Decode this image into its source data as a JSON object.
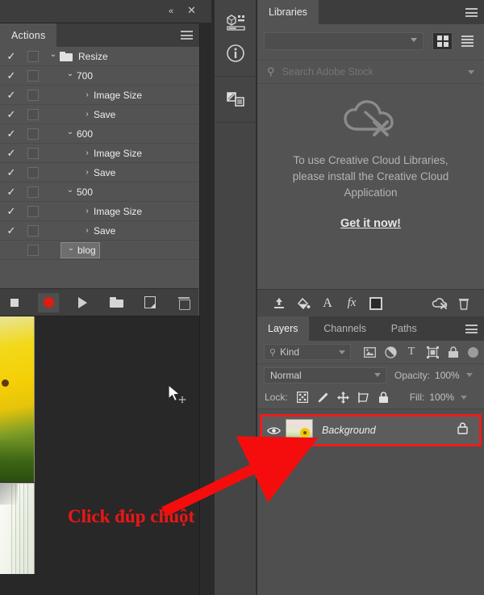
{
  "app": "Adobe Photoshop",
  "actions_panel": {
    "tab_label": "Actions",
    "collapse_icon": "double-chevron-left-icon",
    "close_icon": "close-icon",
    "menu_icon": "panel-menu-icon",
    "rows": [
      {
        "check": "✓",
        "box": true,
        "chevron": "⌄",
        "folder": true,
        "indent": 0,
        "label": "Resize",
        "selected": false
      },
      {
        "check": "✓",
        "box": true,
        "chevron": "⌄",
        "folder": false,
        "indent": 1,
        "label": "700",
        "selected": false
      },
      {
        "check": "✓",
        "box": true,
        "chevron": "›",
        "folder": false,
        "indent": 2,
        "label": "Image Size",
        "selected": false
      },
      {
        "check": "✓",
        "box": true,
        "chevron": "›",
        "folder": false,
        "indent": 2,
        "label": "Save",
        "selected": false
      },
      {
        "check": "✓",
        "box": true,
        "chevron": "⌄",
        "folder": false,
        "indent": 1,
        "label": "600",
        "selected": false
      },
      {
        "check": "✓",
        "box": true,
        "chevron": "›",
        "folder": false,
        "indent": 2,
        "label": "Image Size",
        "selected": false
      },
      {
        "check": "✓",
        "box": true,
        "chevron": "›",
        "folder": false,
        "indent": 2,
        "label": "Save",
        "selected": false
      },
      {
        "check": "✓",
        "box": true,
        "chevron": "⌄",
        "folder": false,
        "indent": 1,
        "label": "500",
        "selected": false
      },
      {
        "check": "✓",
        "box": true,
        "chevron": "›",
        "folder": false,
        "indent": 2,
        "label": "Image Size",
        "selected": false
      },
      {
        "check": "✓",
        "box": true,
        "chevron": "›",
        "folder": false,
        "indent": 2,
        "label": "Save",
        "selected": false
      },
      {
        "check": "",
        "box": true,
        "chevron": "⌄",
        "folder": false,
        "indent": 1,
        "label": "blog",
        "selected": true
      }
    ],
    "toolbar": [
      {
        "name": "stop-button",
        "title": "Stop"
      },
      {
        "name": "record-button",
        "title": "Begin recording"
      },
      {
        "name": "play-button",
        "title": "Play selection"
      },
      {
        "name": "new-set-button",
        "title": "Create new set"
      },
      {
        "name": "new-action-button",
        "title": "Create new action"
      },
      {
        "name": "delete-button",
        "title": "Delete"
      }
    ]
  },
  "icon_rail": {
    "items": [
      {
        "name": "properties-icon",
        "title": "Properties"
      },
      {
        "name": "info-icon",
        "title": "Info"
      },
      {
        "name": "adjustments-icon",
        "title": "Adjustments"
      }
    ]
  },
  "libraries": {
    "tab_label": "Libraries",
    "menu_icon": "panel-menu-icon",
    "library_select_value": "",
    "view_grid_icon": "grid-view-icon",
    "view_list_icon": "list-view-icon",
    "view_active": "grid",
    "search_placeholder": "Search Adobe Stock",
    "search_value": "",
    "search_icon": "search-icon",
    "empty_icon": "cloud-disconnected-icon",
    "empty_message": "To use Creative Cloud Libraries, please install the Creative Cloud Application",
    "cta_label": "Get it now!",
    "toolbar": [
      {
        "name": "upload-icon"
      },
      {
        "name": "paint-bucket-icon"
      },
      {
        "name": "text-icon"
      },
      {
        "name": "fx-icon"
      },
      {
        "name": "color-swatch-icon"
      },
      {
        "name": "cloud-sync-off-icon"
      },
      {
        "name": "trash-icon"
      }
    ]
  },
  "layers": {
    "tabs": [
      {
        "label": "Layers",
        "active": true
      },
      {
        "label": "Channels",
        "active": false
      },
      {
        "label": "Paths",
        "active": false
      }
    ],
    "menu_icon": "panel-menu-icon",
    "filter": {
      "kind_label": "Kind",
      "kind_search_icon": "search-icon",
      "icons": [
        {
          "name": "filter-pixel-icon"
        },
        {
          "name": "filter-adjustment-icon"
        },
        {
          "name": "filter-type-icon"
        },
        {
          "name": "filter-shape-icon"
        },
        {
          "name": "filter-smart-object-icon"
        }
      ],
      "toggle_name": "filter-enable-toggle"
    },
    "blend_mode": "Normal",
    "opacity_label": "Opacity:",
    "opacity_value": "100%",
    "lock_label": "Lock:",
    "lock_icons": [
      {
        "name": "lock-transparent-pixels-icon"
      },
      {
        "name": "lock-image-pixels-icon"
      },
      {
        "name": "lock-position-icon"
      },
      {
        "name": "lock-artboard-nesting-icon"
      },
      {
        "name": "lock-all-icon"
      }
    ],
    "fill_label": "Fill:",
    "fill_value": "100%",
    "rows": [
      {
        "name": "Background",
        "visible": true,
        "locked": true,
        "highlighted": true,
        "eye_icon": "eye-icon",
        "lock_icon": "lock-icon"
      }
    ]
  },
  "annotation": {
    "text": "Click đúp chuột",
    "color": "#e01b1b",
    "arrow_name": "red-arrow-pointer",
    "highlight_color": "#ee1b1b"
  },
  "cursor": {
    "name": "move-tool-cursor"
  },
  "colors": {
    "panel_bg": "#535353",
    "panel_dark": "#3d3d3d",
    "layers_bg": "#4f4f4f",
    "rail_bg": "#454545",
    "canvas_bg": "#282828",
    "record_red": "#e11b12",
    "accent_red": "#ee1b1b"
  }
}
